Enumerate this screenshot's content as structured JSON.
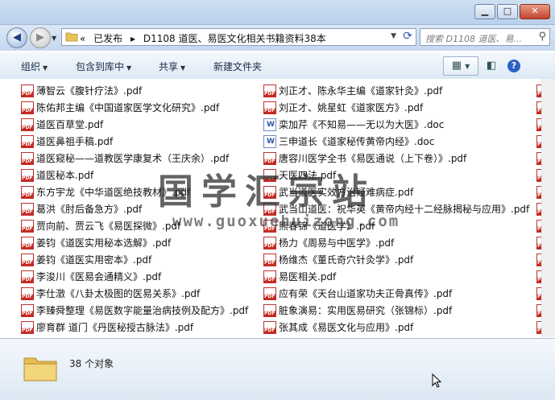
{
  "window": {
    "minimize": "▁",
    "maximize": "□",
    "close": "✕"
  },
  "nav": {
    "back_glyph": "◀",
    "forward_glyph": "▶",
    "dropdown_glyph": "▼"
  },
  "address": {
    "overflow": "«",
    "crumbs": [
      "已发布",
      "D1108 道医、易医文化相关书籍资料38本"
    ],
    "separator": "▸"
  },
  "search": {
    "placeholder": "搜索 D1108 道医、易..."
  },
  "toolbar": {
    "organize": "组织",
    "include_library": "包含到库中",
    "share": "共享",
    "new_folder": "新建文件夹"
  },
  "files": {
    "col1": [
      {
        "name": "薄智云《腹针疗法》.pdf",
        "type": "pdf"
      },
      {
        "name": "陈佑邦主编《中国道家医学文化研究》.pdf",
        "type": "pdf"
      },
      {
        "name": "道医百草堂.pdf",
        "type": "pdf"
      },
      {
        "name": "道医鼻祖手稿.pdf",
        "type": "pdf"
      },
      {
        "name": "道医窥秘——道教医学康复术（王庆余）.pdf",
        "type": "pdf"
      },
      {
        "name": "道医秘本.pdf",
        "type": "pdf"
      },
      {
        "name": "东方宇龙《中华道医绝技教材》.pdf",
        "type": "pdf"
      },
      {
        "name": "葛洪《肘后备急方》.pdf",
        "type": "pdf"
      },
      {
        "name": "贾向前、贾云飞《易医探微》.pdf",
        "type": "pdf"
      },
      {
        "name": "姜钧《道医实用秘本选解》.pdf",
        "type": "pdf"
      },
      {
        "name": "姜钧《道医实用密本》.pdf",
        "type": "pdf"
      },
      {
        "name": "李浚川《医易会通精义》.pdf",
        "type": "pdf"
      },
      {
        "name": "李仕澂《八卦太极图的医易关系》.pdf",
        "type": "pdf"
      },
      {
        "name": "李臻舜整理《易医数字能量治病技例及配方》.pdf",
        "type": "pdf"
      },
      {
        "name": "廖育群 道门《丹医秘授古脉法》.pdf",
        "type": "pdf"
      }
    ],
    "col2": [
      {
        "name": "刘正才、陈永华主编《道家针灸》.pdf",
        "type": "pdf"
      },
      {
        "name": "刘正才、姚星虹《道家医方》.pdf",
        "type": "pdf"
      },
      {
        "name": "栾加芹《不知易——无以为大医》.doc",
        "type": "doc"
      },
      {
        "name": "三申道长《道家秘传黄帝内经》.doc",
        "type": "doc"
      },
      {
        "name": "唐容川医学全书《易医通说（上下卷）》.pdf",
        "type": "pdf"
      },
      {
        "name": "天医四法.pdf",
        "type": "pdf"
      },
      {
        "name": "武当道医实效方治疑难病症.pdf",
        "type": "pdf"
      },
      {
        "name": "武当山道医：祝华英《黄帝内经十二经脉揭秘与应用》.pdf",
        "type": "pdf"
      },
      {
        "name": "熊春锦《道医学》.pdf",
        "type": "pdf"
      },
      {
        "name": "杨力《周易与中医学》.pdf",
        "type": "pdf"
      },
      {
        "name": "杨维杰《董氏奇穴针灸学》.pdf",
        "type": "pdf"
      },
      {
        "name": "易医相关.pdf",
        "type": "pdf"
      },
      {
        "name": "应有荣《天台山道家功夫正骨真传》.pdf",
        "type": "pdf"
      },
      {
        "name": "脏象演易：实用医易研究（张锦标）.pdf",
        "type": "pdf"
      },
      {
        "name": "张其成《易医文化与应用》.pdf",
        "type": "pdf"
      }
    ]
  },
  "watermark": {
    "title": "国学汇宗站",
    "url": "www.guoxuehuizong.com"
  },
  "status": {
    "count_text": "38 个对象"
  }
}
